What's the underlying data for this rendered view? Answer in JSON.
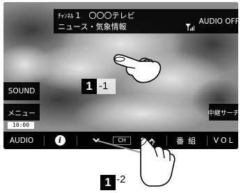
{
  "info": {
    "channel_prefix": "ﾁｬﾝﾈﾙ",
    "channel_number": "1",
    "station": "〇〇〇テレビ",
    "program": "ニュース・気象情報"
  },
  "audio_off": "AUDIO OFF",
  "sound": "SOUND",
  "menu": "メニュー",
  "clock": "10:00",
  "search": "中継サーチ",
  "bottom_bar": {
    "audio": "AUDIO",
    "info_icon": "i",
    "down": "⌄",
    "ch": "CH",
    "up": "⌃",
    "program": "番組",
    "vol": "VOL"
  },
  "callout1": {
    "number": "1",
    "suffix": "-1"
  },
  "callout2": {
    "number": "1",
    "suffix": "-2"
  },
  "colors": {
    "bar": "#000000",
    "text": "#ffffff",
    "sky": "#7f7f7f"
  }
}
